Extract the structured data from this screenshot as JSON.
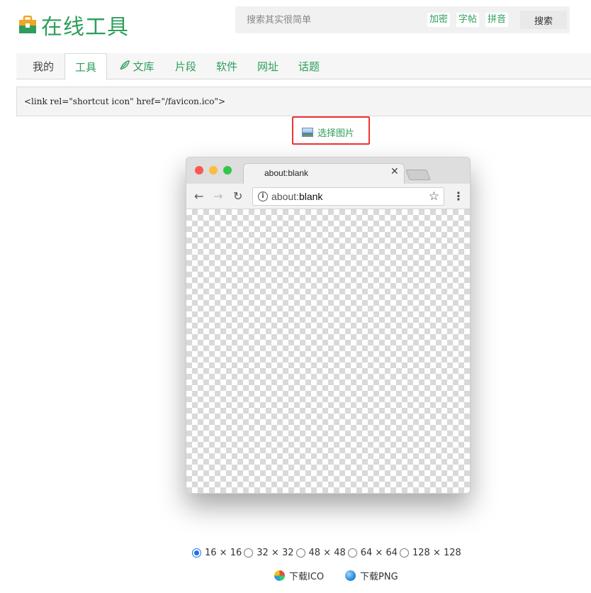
{
  "header": {
    "logo_text": "在线工具",
    "search": {
      "placeholder": "搜索其实很简单",
      "quick_links": [
        "加密",
        "字帖",
        "拼音"
      ],
      "button_label": "搜索"
    }
  },
  "nav": {
    "tabs": [
      {
        "label": "我的",
        "active": false
      },
      {
        "label": "工具",
        "active": true
      },
      {
        "label": "文库",
        "active": false
      },
      {
        "label": "片段",
        "active": false
      },
      {
        "label": "软件",
        "active": false
      },
      {
        "label": "网址",
        "active": false
      },
      {
        "label": "话题",
        "active": false
      }
    ]
  },
  "code_snippet": "<link rel=\"shortcut icon\" href=\"/favicon.ico\">",
  "select_image": {
    "label": "选择图片",
    "icon": "image-icon"
  },
  "browser_preview": {
    "tab_title": "about:blank",
    "url_prefix": "about:",
    "url_main": "blank",
    "icons": [
      "back-icon",
      "forward-icon",
      "reload-icon",
      "info-icon",
      "star-icon",
      "menu-icon",
      "close-icon"
    ]
  },
  "sizes": {
    "options": [
      "16 × 16",
      "32 × 32",
      "48 × 48",
      "64 × 64",
      "128 × 128"
    ],
    "selected": "16 × 16"
  },
  "downloads": {
    "ico_label": "下载ICO",
    "png_label": "下载PNG"
  },
  "colors": {
    "brand_green": "#2e9e5b",
    "highlight_red": "#ee3333",
    "radio_blue": "#1a73e8"
  }
}
